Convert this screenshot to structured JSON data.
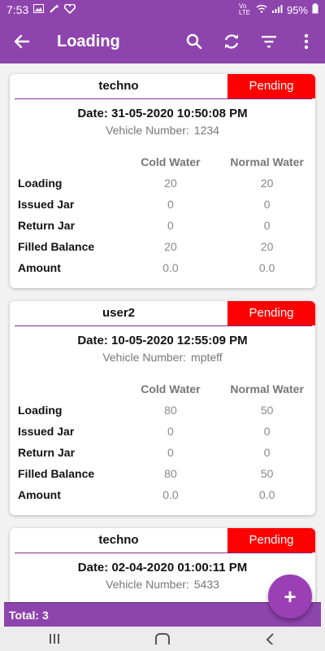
{
  "status_bar": {
    "time": "7:53",
    "battery": "95%",
    "network": "Vo LTE"
  },
  "app_bar": {
    "title": "Loading"
  },
  "table_header": {
    "col1": "Cold Water",
    "col2": "Normal Water"
  },
  "row_labels": [
    "Loading",
    "Issued Jar",
    "Return Jar",
    "Filled Balance",
    "Amount"
  ],
  "cards": [
    {
      "user": "techno",
      "status": "Pending",
      "date": "Date: 31-05-2020 10:50:08 PM",
      "vehicle_label": "Vehicle Number:",
      "vehicle": "1234",
      "values": [
        [
          "20",
          "20"
        ],
        [
          "0",
          "0"
        ],
        [
          "0",
          "0"
        ],
        [
          "20",
          "20"
        ],
        [
          "0.0",
          "0.0"
        ]
      ]
    },
    {
      "user": "user2",
      "status": "Pending",
      "date": "Date: 10-05-2020 12:55:09 PM",
      "vehicle_label": "Vehicle Number:",
      "vehicle": "mpteff",
      "values": [
        [
          "80",
          "50"
        ],
        [
          "0",
          "0"
        ],
        [
          "0",
          "0"
        ],
        [
          "80",
          "50"
        ],
        [
          "0.0",
          "0.0"
        ]
      ]
    },
    {
      "user": "techno",
      "status": "Pending",
      "date": "Date: 02-04-2020 01:00:11 PM",
      "vehicle_label": "Vehicle Number:",
      "vehicle": "5433",
      "values": []
    }
  ],
  "footer": {
    "total": "Total: 3"
  },
  "fab": {
    "label": "+"
  },
  "colors": {
    "primary": "#8e44ad",
    "status_pending": "#ff0000"
  }
}
